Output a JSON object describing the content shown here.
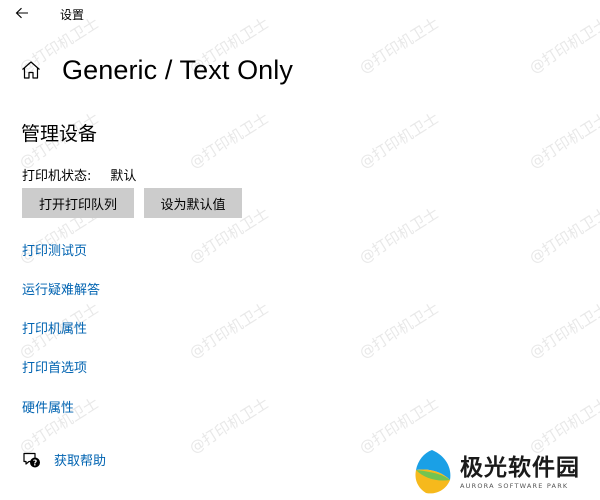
{
  "window": {
    "title": "设置",
    "back_icon": "back-arrow-icon"
  },
  "header": {
    "icon": "home-icon",
    "title": "Generic / Text Only"
  },
  "section": {
    "title": "管理设备"
  },
  "status": {
    "label": "打印机状态:",
    "value": "默认"
  },
  "buttons": {
    "open_queue": "打开打印队列",
    "set_default": "设为默认值"
  },
  "links": [
    "打印测试页",
    "运行疑难解答",
    "打印机属性",
    "打印首选项",
    "硬件属性"
  ],
  "help": {
    "icon": "help-chat-icon",
    "label": "获取帮助"
  },
  "watermark": {
    "text": "@打印机卫士"
  },
  "brand": {
    "name": "极光软件园",
    "subtitle": "AURORA SOFTWARE PARK"
  },
  "colors": {
    "link": "#0063b1",
    "button_bg": "#cccccc",
    "background": "#ffffff"
  }
}
